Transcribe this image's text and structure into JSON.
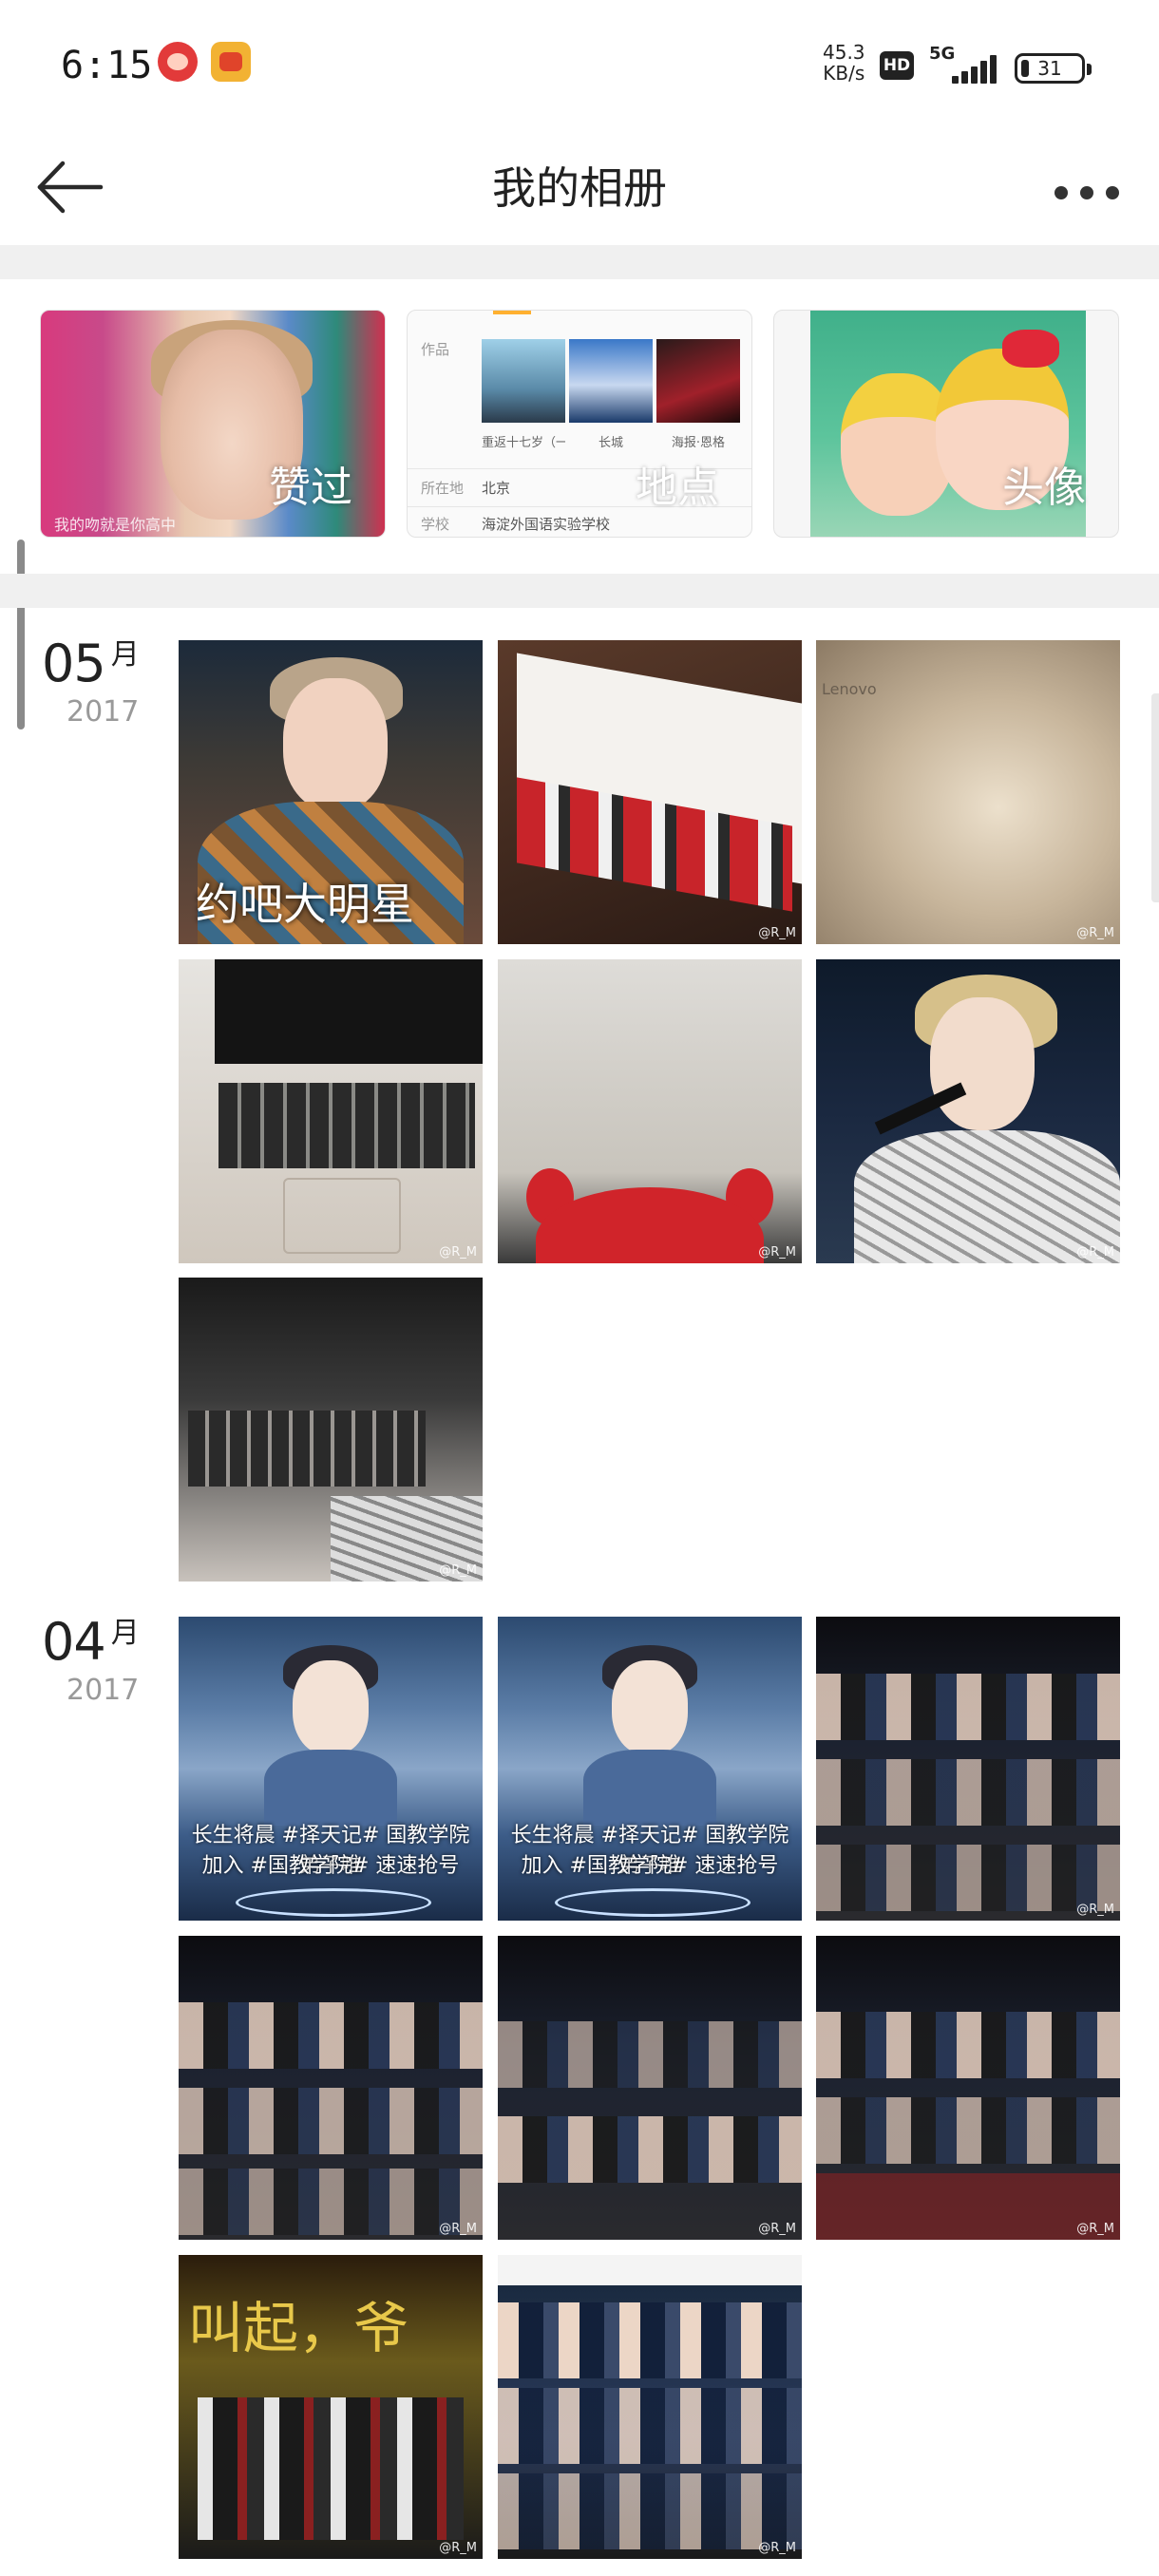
{
  "status_bar": {
    "time": "6:15",
    "net_speed_value": "45.3",
    "net_speed_unit": "KB/s",
    "hd_badge": "HD",
    "network_type": "5G",
    "battery_level": "31"
  },
  "header": {
    "title": "我的相册",
    "back_icon": "back-arrow-icon",
    "more_icon": "more-dots-icon"
  },
  "categories": [
    {
      "label": "赞过",
      "caption": "我的吻就是你高中"
    },
    {
      "label": "地点",
      "row_label_works": "作品",
      "works": [
        "重返十七岁（一",
        "长城",
        "海报·恩格"
      ],
      "row_label_location": "所在地",
      "location_value": "北京",
      "row_label_school": "学校",
      "school_value": "海淀外国语实验学校"
    },
    {
      "label": "头像"
    }
  ],
  "sections": [
    {
      "month": "05",
      "month_unit": "月",
      "year": "2017",
      "photos": [
        {
          "kind": "poster",
          "text": "约吧大明星"
        },
        {
          "kind": "box",
          "watermark": "@R_M"
        },
        {
          "kind": "lenovo",
          "text": "Lenovo",
          "watermark": "@R_M"
        },
        {
          "kind": "laptop",
          "watermark": "@R_M"
        },
        {
          "kind": "redbox",
          "watermark": "@R_M"
        },
        {
          "kind": "singer",
          "watermark": "@R_M"
        },
        {
          "kind": "laptop2",
          "watermark": "@R_M"
        }
      ]
    },
    {
      "month": "04",
      "month_unit": "月",
      "year": "2017",
      "photos": [
        {
          "kind": "ad",
          "line1": "长生将晨 #择天记# 国教学院弟子唯",
          "line2": "加入 #国教学院# 速速抢号"
        },
        {
          "kind": "ad",
          "line1": "长生将晨 #择天记# 国教学院弟子唯",
          "line2": "加入 #国教学院# 速速抢号"
        },
        {
          "kind": "crowd",
          "watermark": "@R_M"
        },
        {
          "kind": "crowd",
          "watermark": "@R_M"
        },
        {
          "kind": "crowd",
          "watermark": "@R_M"
        },
        {
          "kind": "crowd",
          "watermark": "@R_M"
        },
        {
          "kind": "stage",
          "text": "叫起，爷",
          "watermark": "@R_M"
        },
        {
          "kind": "group",
          "watermark": "@R_M"
        }
      ]
    }
  ],
  "colors": {
    "background": "#ffffff",
    "divider_band": "#f0f0f0",
    "month_text": "#222222",
    "year_text": "#999999"
  }
}
